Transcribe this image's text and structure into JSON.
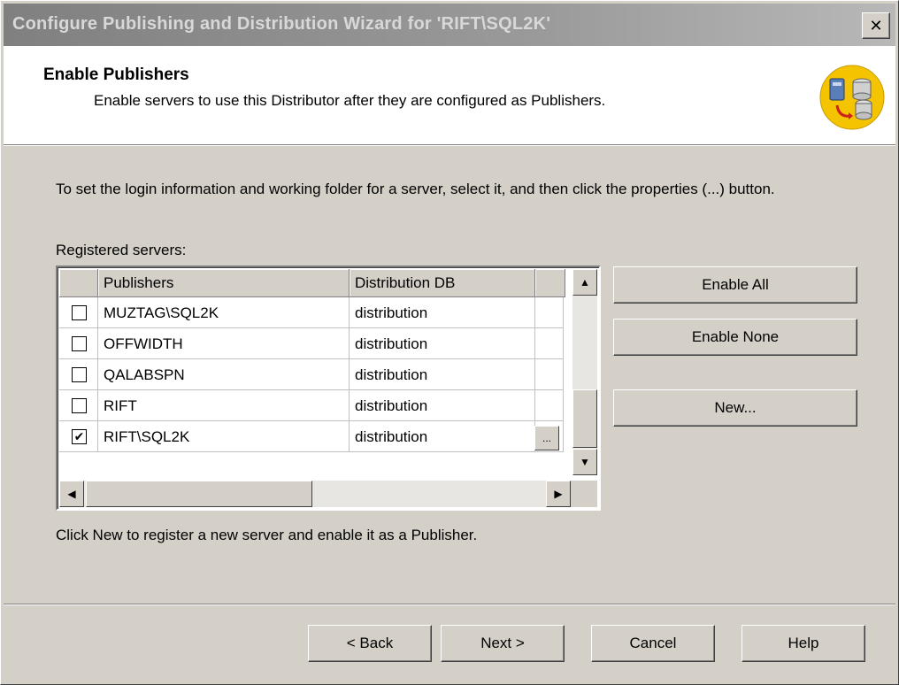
{
  "window": {
    "title": "Configure Publishing and Distribution Wizard for 'RIFT\\SQL2K'",
    "close_glyph": "✕"
  },
  "header": {
    "title": "Enable Publishers",
    "subtitle": "Enable servers to use this Distributor after they are configured as Publishers.",
    "logo_icon": "servers-replication-icon"
  },
  "content": {
    "instructions": "To set the login information and working folder for a server, select it, and then click the properties (...) button.",
    "registered_label": "Registered servers:",
    "footer_note": "Click New to register a new server and enable it as a Publisher."
  },
  "grid": {
    "columns": [
      "Publishers",
      "Distribution DB"
    ],
    "rows": [
      {
        "checked": false,
        "publisher": "MUZTAG\\SQL2K",
        "db": "distribution"
      },
      {
        "checked": false,
        "publisher": "OFFWIDTH",
        "db": "distribution"
      },
      {
        "checked": false,
        "publisher": "QALABSPN",
        "db": "distribution"
      },
      {
        "checked": false,
        "publisher": "RIFT",
        "db": "distribution"
      },
      {
        "checked": true,
        "publisher": "RIFT\\SQL2K",
        "db": "distribution"
      }
    ],
    "ellipsis_label": "...",
    "checkmark_glyph": "✔"
  },
  "side_buttons": {
    "enable_all": "Enable All",
    "enable_none": "Enable None",
    "new": "New..."
  },
  "nav_buttons": {
    "back": "< Back",
    "next": "Next >",
    "cancel": "Cancel",
    "help": "Help"
  },
  "colors": {
    "face": "#d4d0c8",
    "titlebar": "#9a9a9a",
    "logo": "#f5c400"
  }
}
